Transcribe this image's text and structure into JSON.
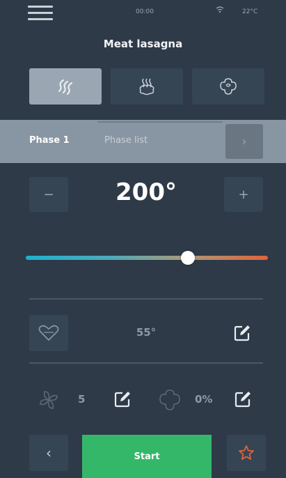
{
  "status": {
    "time": "00:00",
    "wifi_icon": "wifi-icon",
    "temperature": "22°C"
  },
  "recipe": {
    "title": "Meat lasagna"
  },
  "modes": [
    {
      "icon": "convection-heat-icon",
      "active": true
    },
    {
      "icon": "steam-icon",
      "active": false
    },
    {
      "icon": "combi-icon",
      "active": false
    }
  ],
  "phase": {
    "current": "Phase 1",
    "list_label": "Phase list",
    "next_icon": "chevron-right-icon"
  },
  "temperature": {
    "value": "200°",
    "minus_label": "−",
    "plus_label": "+",
    "slider_fraction": 0.67
  },
  "core_probe": {
    "icon": "core-probe-icon",
    "value": "55°",
    "edit_icon": "edit-icon"
  },
  "fan": {
    "icon": "fan-icon",
    "value": "5",
    "edit_icon": "edit-icon"
  },
  "humidity": {
    "icon": "humidity-icon",
    "value": "0%",
    "edit_icon": "edit-icon"
  },
  "footer": {
    "back_label": "‹",
    "start_label": "Start",
    "favorite_icon": "star-icon"
  },
  "colors": {
    "background": "#2e3a47",
    "start": "#35b76a",
    "star": "#e0633c",
    "slider_cold": "#1fb0d0",
    "slider_hot": "#e0633c"
  }
}
